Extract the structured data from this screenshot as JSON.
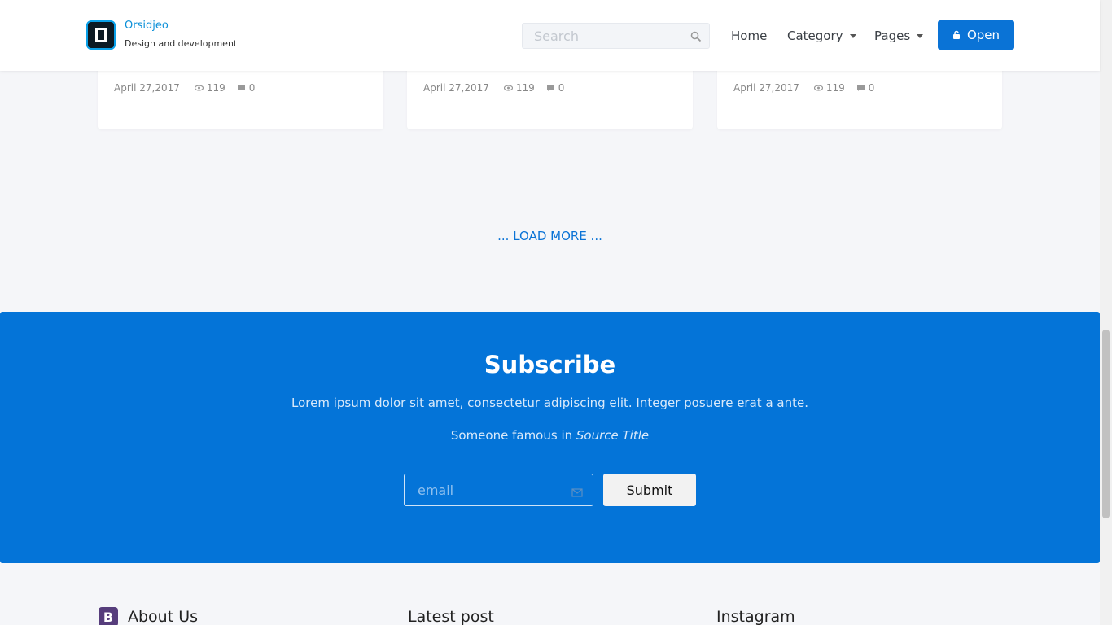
{
  "header": {
    "brand_name": "Orsidjeo",
    "brand_tagline": "Design and development",
    "search_placeholder": "Search",
    "nav": {
      "home": "Home",
      "category": "Category",
      "pages": "Pages"
    },
    "open_button": "Open"
  },
  "cards": [
    {
      "date": "April 27,2017",
      "views": "119",
      "comments": "0"
    },
    {
      "date": "April 27,2017",
      "views": "119",
      "comments": "0"
    },
    {
      "date": "April 27,2017",
      "views": "119",
      "comments": "0"
    }
  ],
  "load_more": "... LOAD MORE ...",
  "subscribe": {
    "title": "Subscribe",
    "text": "Lorem ipsum dolor sit amet, consectetur adipiscing elit. Integer posuere erat a ante.",
    "quote_prefix": "Someone famous in ",
    "quote_source": "Source Title",
    "email_placeholder": "email",
    "submit_label": "Submit"
  },
  "footer": {
    "about_icon_letter": "B",
    "about_title": "About Us",
    "latest_title": "Latest post",
    "instagram_title": "Instagram"
  },
  "colors": {
    "accent": "#0474d8",
    "brand_link": "#0a8fd8"
  }
}
